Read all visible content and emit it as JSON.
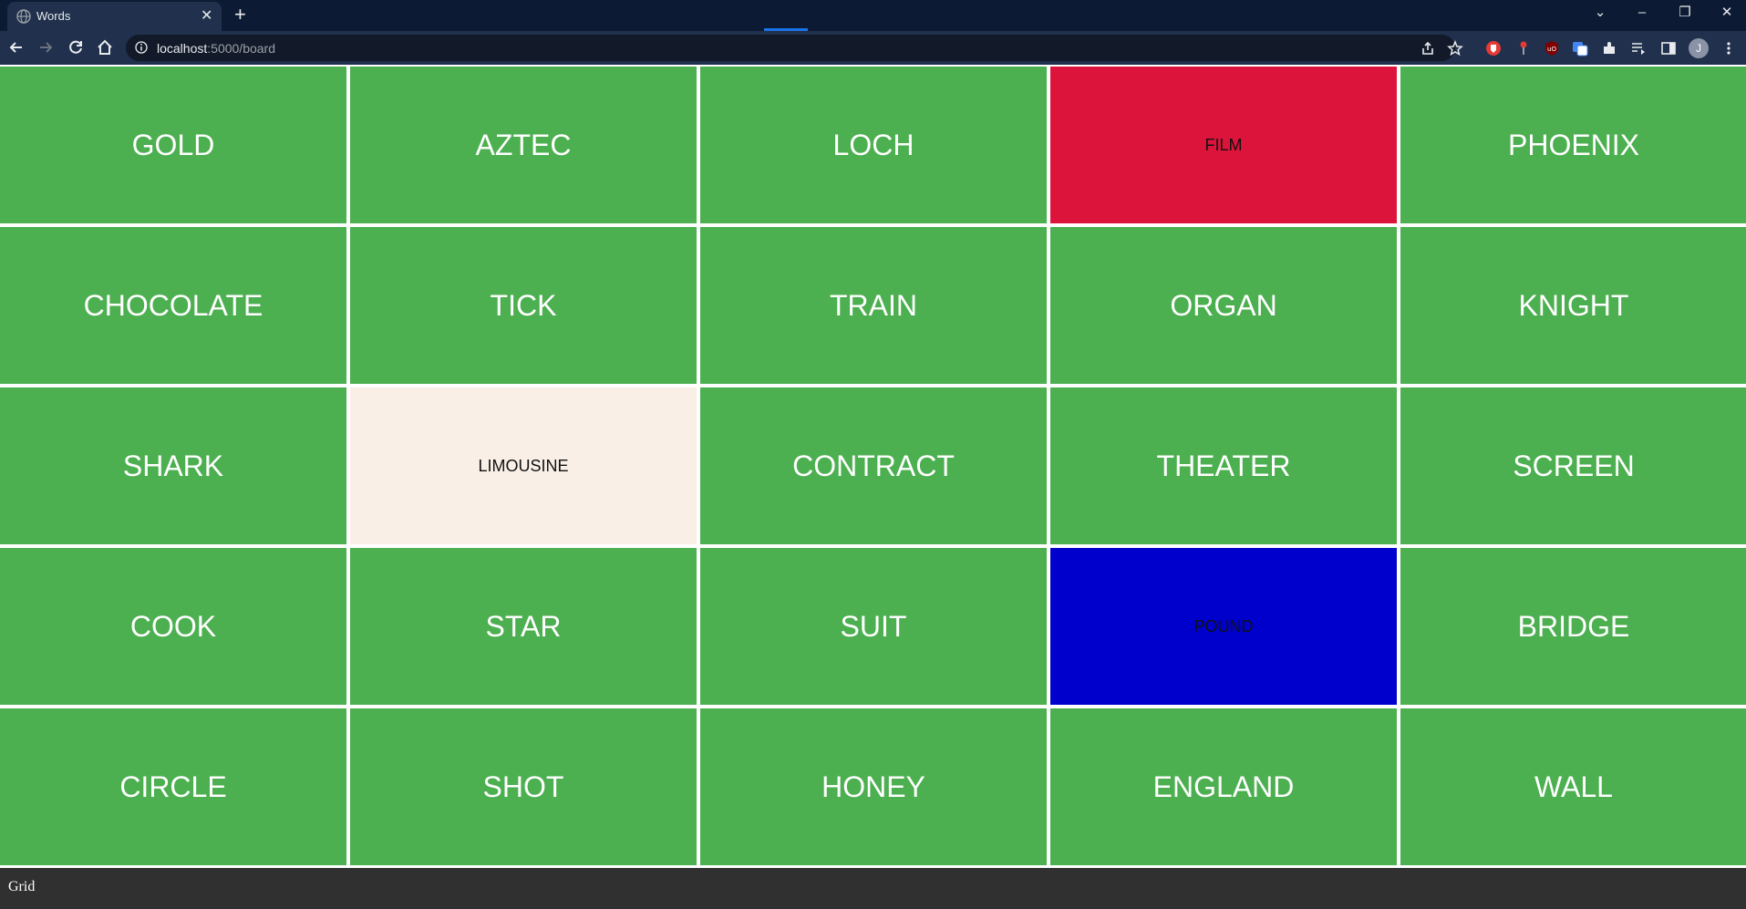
{
  "browser": {
    "tab_title": "Words",
    "tab_close": "✕",
    "new_tab": "+",
    "url_host": "localhost",
    "url_rest": ":5000/board",
    "avatar_initial": "J",
    "window_controls": {
      "tab_search": "⌄",
      "minimize": "–",
      "restore": "❐",
      "close": "✕"
    }
  },
  "board": {
    "cards": [
      {
        "word": "GOLD",
        "color": "green"
      },
      {
        "word": "AZTEC",
        "color": "green"
      },
      {
        "word": "LOCH",
        "color": "green"
      },
      {
        "word": "FILM",
        "color": "red"
      },
      {
        "word": "PHOENIX",
        "color": "green"
      },
      {
        "word": "CHOCOLATE",
        "color": "green"
      },
      {
        "word": "TICK",
        "color": "green"
      },
      {
        "word": "TRAIN",
        "color": "green"
      },
      {
        "word": "ORGAN",
        "color": "green"
      },
      {
        "word": "KNIGHT",
        "color": "green"
      },
      {
        "word": "SHARK",
        "color": "green"
      },
      {
        "word": "LIMOUSINE",
        "color": "neutral"
      },
      {
        "word": "CONTRACT",
        "color": "green"
      },
      {
        "word": "THEATER",
        "color": "green"
      },
      {
        "word": "SCREEN",
        "color": "green"
      },
      {
        "word": "COOK",
        "color": "green"
      },
      {
        "word": "STAR",
        "color": "green"
      },
      {
        "word": "SUIT",
        "color": "green"
      },
      {
        "word": "POUND",
        "color": "blue"
      },
      {
        "word": "BRIDGE",
        "color": "green"
      },
      {
        "word": "CIRCLE",
        "color": "green"
      },
      {
        "word": "SHOT",
        "color": "green"
      },
      {
        "word": "HONEY",
        "color": "green"
      },
      {
        "word": "ENGLAND",
        "color": "green"
      },
      {
        "word": "WALL",
        "color": "green"
      }
    ]
  },
  "colors": {
    "green": "#4caf50",
    "red": "#dc143c",
    "blue": "#0000cd",
    "neutral": "#faefe7"
  },
  "footer": {
    "label": "Grid"
  }
}
